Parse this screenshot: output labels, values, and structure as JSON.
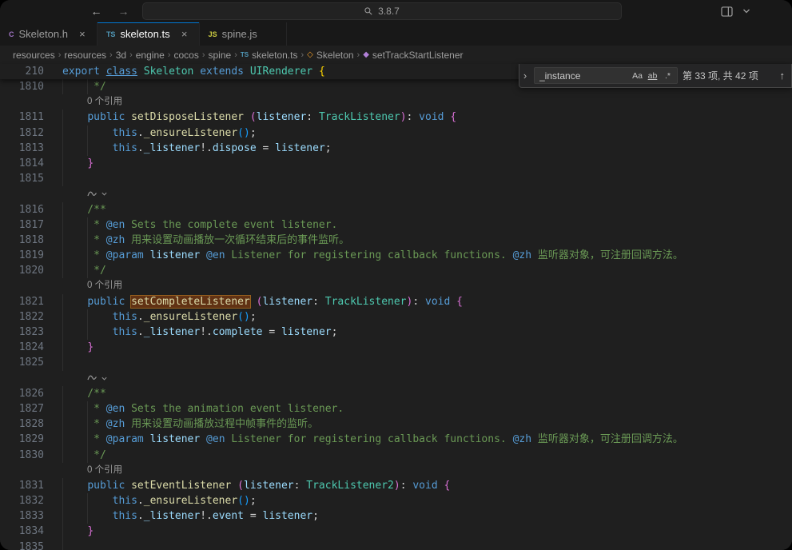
{
  "theme": {
    "accent": "#0078d4",
    "titlebar_bg": "#181818",
    "editor_bg": "#1f1f1f",
    "keyword_color": "#569cd6",
    "function_color": "#dcdcaa",
    "type_color": "#4ec9b0",
    "variable_color": "#9cdcfe",
    "comment_color": "#6a9955",
    "match_highlight_bg": "#613214"
  },
  "titlebar": {
    "back_icon": "←",
    "forward_icon": "→",
    "search_icon": "magnifier",
    "search_value": "3.8.7",
    "layout_icon": "panel-layout",
    "layout_dropdown_icon": "chevron-down"
  },
  "tabs": [
    {
      "label": "Skeleton.h",
      "icon_label": "C",
      "icon_name": "c-file-icon",
      "icon_color": "#a074c4",
      "active": false,
      "close_icon": "×"
    },
    {
      "label": "skeleton.ts",
      "icon_label": "TS",
      "icon_name": "ts-file-icon",
      "icon_color": "#519aba",
      "active": true,
      "close_icon": "×"
    },
    {
      "label": "spine.js",
      "icon_label": "JS",
      "icon_name": "js-file-icon",
      "icon_color": "#cbcb41",
      "active": false,
      "close_icon": ""
    }
  ],
  "breadcrumbs": {
    "separator": "›",
    "items": [
      {
        "label": "resources"
      },
      {
        "label": "resources"
      },
      {
        "label": "3d"
      },
      {
        "label": "engine"
      },
      {
        "label": "cocos"
      },
      {
        "label": "spine"
      },
      {
        "label": "skeleton.ts",
        "icon": "ts"
      },
      {
        "label": "Skeleton",
        "icon": "class"
      },
      {
        "label": "setTrackStartListener",
        "icon": "method"
      }
    ]
  },
  "find_widget": {
    "expand_icon": "›",
    "query": "_instance",
    "match_case_label": "Aa",
    "whole_word_label": "ab",
    "regex_label": ".*",
    "results_count": "第 33 项, 共 42 项",
    "previous_icon": "↑"
  },
  "editor": {
    "sticky": {
      "num": "210",
      "tokens": [
        [
          "k",
          "export"
        ],
        [
          "p",
          " "
        ],
        [
          "ku",
          "class"
        ],
        [
          "p",
          " "
        ],
        [
          "t",
          "Skeleton"
        ],
        [
          "p",
          " "
        ],
        [
          "k",
          "extends"
        ],
        [
          "p",
          " "
        ],
        [
          "t",
          "UIRenderer"
        ],
        [
          "p",
          " "
        ],
        [
          "b1",
          "{"
        ]
      ]
    },
    "codelens_label": "0 个引用",
    "rows": [
      {
        "num": "1810",
        "g": 2,
        "tokens": [
          [
            "c",
            "     */"
          ]
        ]
      },
      {
        "type": "lens",
        "text": "0 个引用"
      },
      {
        "num": "1811",
        "g": 1,
        "tokens": [
          [
            "p",
            "    "
          ],
          [
            "k",
            "public"
          ],
          [
            "p",
            " "
          ],
          [
            "f",
            "setDisposeListener"
          ],
          [
            "p",
            " "
          ],
          [
            "b2",
            "("
          ],
          [
            "v",
            "listener"
          ],
          [
            "p",
            ": "
          ],
          [
            "t",
            "TrackListener"
          ],
          [
            "b2",
            ")"
          ],
          [
            "p",
            ": "
          ],
          [
            "k",
            "void"
          ],
          [
            "p",
            " "
          ],
          [
            "b2",
            "{"
          ]
        ]
      },
      {
        "num": "1812",
        "g": 2,
        "tokens": [
          [
            "p",
            "        "
          ],
          [
            "k",
            "this"
          ],
          [
            "p",
            "."
          ],
          [
            "f",
            "_ensureListener"
          ],
          [
            "b3",
            "("
          ],
          [
            "b3",
            ")"
          ],
          [
            "p",
            ";"
          ]
        ]
      },
      {
        "num": "1813",
        "g": 2,
        "tokens": [
          [
            "p",
            "        "
          ],
          [
            "k",
            "this"
          ],
          [
            "p",
            "."
          ],
          [
            "v",
            "_listener"
          ],
          [
            "p",
            "!."
          ],
          [
            "v",
            "dispose"
          ],
          [
            "p",
            " = "
          ],
          [
            "v",
            "listener"
          ],
          [
            "p",
            ";"
          ]
        ]
      },
      {
        "num": "1814",
        "g": 1,
        "tokens": [
          [
            "p",
            "    "
          ],
          [
            "b2",
            "}"
          ]
        ]
      },
      {
        "num": "1815",
        "g": 1,
        "tokens": []
      },
      {
        "type": "icon"
      },
      {
        "num": "1816",
        "g": 1,
        "tokens": [
          [
            "c",
            "    /**"
          ]
        ]
      },
      {
        "num": "1817",
        "g": 2,
        "tokens": [
          [
            "c",
            "     * "
          ],
          [
            "g",
            "@en"
          ],
          [
            "c",
            " Sets the complete event listener."
          ]
        ]
      },
      {
        "num": "1818",
        "g": 2,
        "tokens": [
          [
            "c",
            "     * "
          ],
          [
            "g",
            "@zh"
          ],
          [
            "c",
            " 用来设置动画播放一次循环结束后的事件监听。"
          ]
        ]
      },
      {
        "num": "1819",
        "g": 2,
        "tokens": [
          [
            "c",
            "     * "
          ],
          [
            "g",
            "@param"
          ],
          [
            "c",
            " "
          ],
          [
            "v",
            "listener"
          ],
          [
            "c",
            " "
          ],
          [
            "g",
            "@en"
          ],
          [
            "c",
            " Listener for registering callback functions. "
          ],
          [
            "g",
            "@zh"
          ],
          [
            "c",
            " 监听器对象，可注册回调方法。"
          ]
        ]
      },
      {
        "num": "1820",
        "g": 2,
        "tokens": [
          [
            "c",
            "     */"
          ]
        ]
      },
      {
        "type": "lens",
        "text": "0 个引用"
      },
      {
        "num": "1821",
        "g": 1,
        "tokens": [
          [
            "p",
            "    "
          ],
          [
            "k",
            "public"
          ],
          [
            "p",
            " "
          ],
          [
            "m",
            "setCompleteListener"
          ],
          [
            "p",
            " "
          ],
          [
            "b2",
            "("
          ],
          [
            "v",
            "listener"
          ],
          [
            "p",
            ": "
          ],
          [
            "t",
            "TrackListener"
          ],
          [
            "b2",
            ")"
          ],
          [
            "p",
            ": "
          ],
          [
            "k",
            "void"
          ],
          [
            "p",
            " "
          ],
          [
            "b2",
            "{"
          ]
        ]
      },
      {
        "num": "1822",
        "g": 2,
        "tokens": [
          [
            "p",
            "        "
          ],
          [
            "k",
            "this"
          ],
          [
            "p",
            "."
          ],
          [
            "f",
            "_ensureListener"
          ],
          [
            "b3",
            "("
          ],
          [
            "b3",
            ")"
          ],
          [
            "p",
            ";"
          ]
        ]
      },
      {
        "num": "1823",
        "g": 2,
        "tokens": [
          [
            "p",
            "        "
          ],
          [
            "k",
            "this"
          ],
          [
            "p",
            "."
          ],
          [
            "v",
            "_listener"
          ],
          [
            "p",
            "!."
          ],
          [
            "v",
            "complete"
          ],
          [
            "p",
            " = "
          ],
          [
            "v",
            "listener"
          ],
          [
            "p",
            ";"
          ]
        ]
      },
      {
        "num": "1824",
        "g": 1,
        "tokens": [
          [
            "p",
            "    "
          ],
          [
            "b2",
            "}"
          ]
        ]
      },
      {
        "num": "1825",
        "g": 1,
        "tokens": []
      },
      {
        "type": "icon"
      },
      {
        "num": "1826",
        "g": 1,
        "tokens": [
          [
            "c",
            "    /**"
          ]
        ]
      },
      {
        "num": "1827",
        "g": 2,
        "tokens": [
          [
            "c",
            "     * "
          ],
          [
            "g",
            "@en"
          ],
          [
            "c",
            " Sets the animation event listener."
          ]
        ]
      },
      {
        "num": "1828",
        "g": 2,
        "tokens": [
          [
            "c",
            "     * "
          ],
          [
            "g",
            "@zh"
          ],
          [
            "c",
            " 用来设置动画播放过程中帧事件的监听。"
          ]
        ]
      },
      {
        "num": "1829",
        "g": 2,
        "tokens": [
          [
            "c",
            "     * "
          ],
          [
            "g",
            "@param"
          ],
          [
            "c",
            " "
          ],
          [
            "v",
            "listener"
          ],
          [
            "c",
            " "
          ],
          [
            "g",
            "@en"
          ],
          [
            "c",
            " Listener for registering callback functions. "
          ],
          [
            "g",
            "@zh"
          ],
          [
            "c",
            " 监听器对象，可注册回调方法。"
          ]
        ]
      },
      {
        "num": "1830",
        "g": 2,
        "tokens": [
          [
            "c",
            "     */"
          ]
        ]
      },
      {
        "type": "lens",
        "text": "0 个引用"
      },
      {
        "num": "1831",
        "g": 1,
        "tokens": [
          [
            "p",
            "    "
          ],
          [
            "k",
            "public"
          ],
          [
            "p",
            " "
          ],
          [
            "f",
            "setEventListener"
          ],
          [
            "p",
            " "
          ],
          [
            "b2",
            "("
          ],
          [
            "v",
            "listener"
          ],
          [
            "p",
            ": "
          ],
          [
            "t",
            "TrackListener2"
          ],
          [
            "b2",
            ")"
          ],
          [
            "p",
            ": "
          ],
          [
            "k",
            "void"
          ],
          [
            "p",
            " "
          ],
          [
            "b2",
            "{"
          ]
        ]
      },
      {
        "num": "1832",
        "g": 2,
        "tokens": [
          [
            "p",
            "        "
          ],
          [
            "k",
            "this"
          ],
          [
            "p",
            "."
          ],
          [
            "f",
            "_ensureListener"
          ],
          [
            "b3",
            "("
          ],
          [
            "b3",
            ")"
          ],
          [
            "p",
            ";"
          ]
        ]
      },
      {
        "num": "1833",
        "g": 2,
        "tokens": [
          [
            "p",
            "        "
          ],
          [
            "k",
            "this"
          ],
          [
            "p",
            "."
          ],
          [
            "v",
            "_listener"
          ],
          [
            "p",
            "!."
          ],
          [
            "v",
            "event"
          ],
          [
            "p",
            " = "
          ],
          [
            "v",
            "listener"
          ],
          [
            "p",
            ";"
          ]
        ]
      },
      {
        "num": "1834",
        "g": 1,
        "tokens": [
          [
            "p",
            "    "
          ],
          [
            "b2",
            "}"
          ]
        ]
      },
      {
        "num": "1835",
        "g": 1,
        "tokens": []
      }
    ]
  }
}
